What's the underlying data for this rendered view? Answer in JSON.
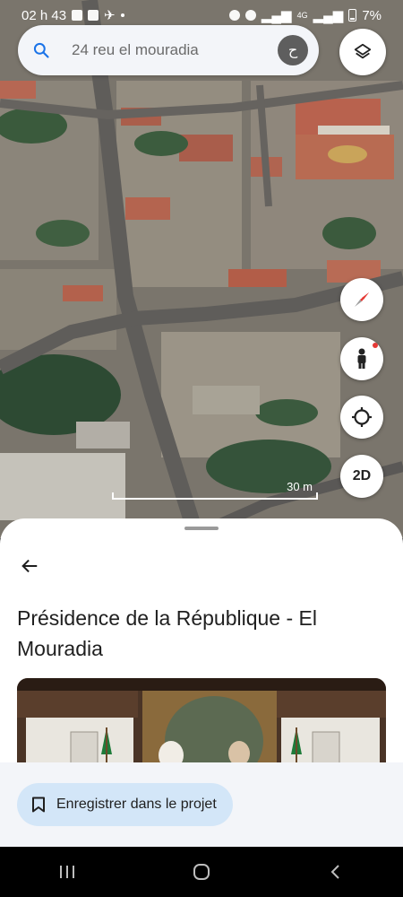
{
  "status_bar": {
    "time": "02 h 43",
    "battery": "7%",
    "network": "4G"
  },
  "search": {
    "query": "24 reu el mouradia",
    "avatar_initial": "ح"
  },
  "map_controls": {
    "two_d_label": "2D",
    "scale_label": "30 m"
  },
  "place": {
    "title": "Présidence de la République - El Mouradia"
  },
  "actions": {
    "save_label": "Enregistrer dans le projet"
  },
  "colors": {
    "accent_blue": "#1a73e8",
    "save_button_bg": "#d3e6f8",
    "compass_red": "#e53935"
  }
}
